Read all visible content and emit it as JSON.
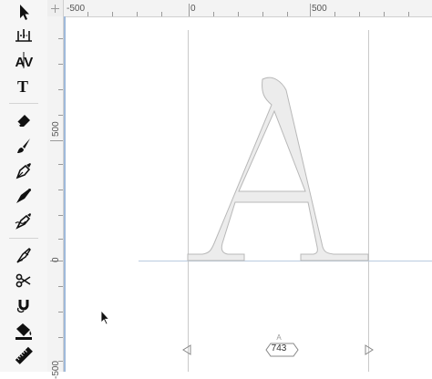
{
  "tools": [
    {
      "id": "select",
      "icon": "arrow-pointer-icon",
      "label": "Select"
    },
    {
      "id": "metrics",
      "icon": "metrics-icon",
      "label": "Metrics"
    },
    {
      "id": "kerning",
      "icon": "kerning-av-icon",
      "label": "Kerning"
    },
    {
      "id": "text",
      "icon": "text-t-icon",
      "label": "Text"
    },
    {
      "id": "eraser",
      "icon": "eraser-icon",
      "label": "Eraser"
    },
    {
      "id": "brush",
      "icon": "brush-icon",
      "label": "Brush"
    },
    {
      "id": "pen",
      "icon": "pen-icon",
      "label": "Pen"
    },
    {
      "id": "calligraphy",
      "icon": "calligraphy-pen-icon",
      "label": "Calligraphy"
    },
    {
      "id": "spiro",
      "icon": "spiro-pen-icon",
      "label": "Spiro"
    },
    {
      "id": "knife",
      "icon": "knife-icon",
      "label": "Knife"
    },
    {
      "id": "scissors",
      "icon": "scissors-icon",
      "label": "Scissors"
    },
    {
      "id": "magnet",
      "icon": "magnet-icon",
      "label": "Magnet"
    },
    {
      "id": "fill",
      "icon": "paint-bucket-icon",
      "label": "Fill"
    },
    {
      "id": "ruler",
      "icon": "ruler-icon",
      "label": "Measure"
    }
  ],
  "ruler": {
    "top_labels": [
      "-500",
      "0",
      "500"
    ],
    "left_labels": [
      "500",
      "0",
      "-500"
    ],
    "corner_icon": "plus-icon"
  },
  "glyph": {
    "character": "A",
    "name": "A",
    "advance_width": "743"
  },
  "colors": {
    "glyph_fill": "#ececec",
    "glyph_stroke": "#b8b8b8",
    "guide": "#c9c9c9",
    "baseline": "#b9cbe0",
    "accent": "#9fb9da"
  },
  "sidebearing_handles": [
    "left-sidebearing-arrow-icon",
    "right-sidebearing-arrow-icon"
  ]
}
